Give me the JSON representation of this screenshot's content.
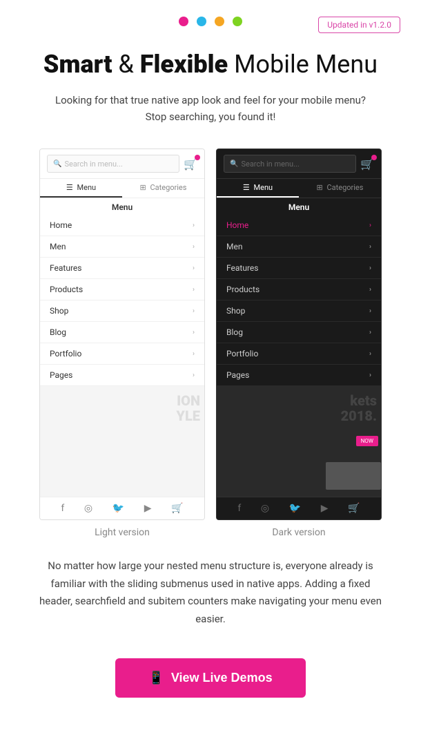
{
  "topbar": {
    "dots": [
      {
        "color": "#e91e8c"
      },
      {
        "color": "#29b6e8"
      },
      {
        "color": "#f5a623"
      },
      {
        "color": "#7ed321"
      }
    ],
    "badge": "Updated in v1.2.0"
  },
  "title": {
    "bold1": "Smart",
    "connector": " & ",
    "bold2": "Flexible",
    "rest": " Mobile Menu",
    "subtitle": "Looking for that true native app look and feel for your mobile menu? Stop searching, you found it!"
  },
  "screenshots": {
    "light": {
      "label": "Light version",
      "search_placeholder": "Search in menu...",
      "tabs": [
        "Menu",
        "Categories"
      ],
      "menu_title": "Menu",
      "items": [
        "Home",
        "Men",
        "Features",
        "Products",
        "Shop",
        "Blog",
        "Portfolio",
        "Pages"
      ],
      "active_item": ""
    },
    "dark": {
      "label": "Dark version",
      "search_placeholder": "Search in menu...",
      "tabs": [
        "Menu",
        "Categories"
      ],
      "menu_title": "Menu",
      "items": [
        "Home",
        "Men",
        "Features",
        "Products",
        "Shop",
        "Blog",
        "Portfolio",
        "Pages"
      ],
      "active_item": "Home"
    }
  },
  "description": "No matter how large your nested menu structure is, everyone already is familiar with the sliding submenus used in native apps. Adding a fixed header, searchfield and subitem counters make navigating your menu even easier.",
  "cta": {
    "label": "View Live Demos"
  }
}
